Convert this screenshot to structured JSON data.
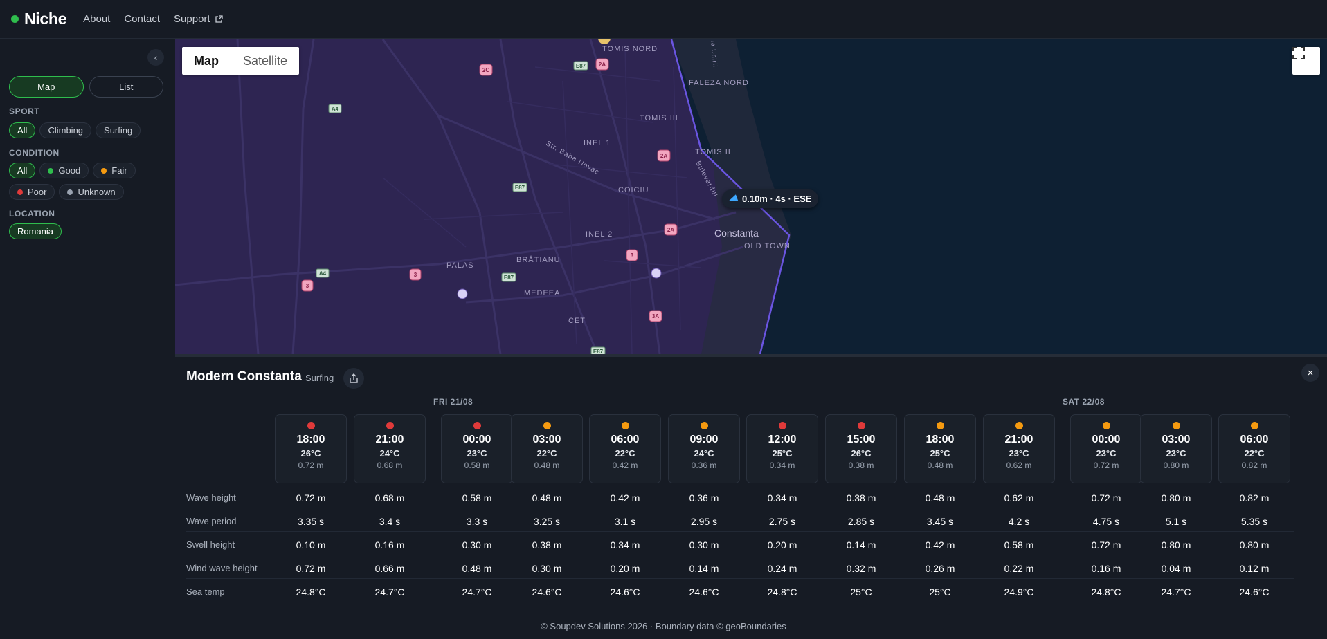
{
  "header": {
    "logo": "Niche",
    "nav": [
      "About",
      "Contact",
      "Support"
    ]
  },
  "sidebar": {
    "view_toggle": [
      "Map",
      "List"
    ],
    "sport_label": "SPORT",
    "sport": [
      "All",
      "Climbing",
      "Surfing"
    ],
    "condition_label": "CONDITION",
    "condition": [
      {
        "label": "All",
        "color": ""
      },
      {
        "label": "Good",
        "color": "#2fbd4d"
      },
      {
        "label": "Fair",
        "color": "#f59a10"
      },
      {
        "label": "Poor",
        "color": "#e03a3a"
      },
      {
        "label": "Unknown",
        "color": "#9aa3b0"
      }
    ],
    "location_label": "LOCATION",
    "location": [
      "Romania"
    ]
  },
  "map": {
    "toggle": [
      "Map",
      "Satellite"
    ],
    "wave_label": "0.10m · 4s · ESE",
    "place_labels": [
      "TOMIS NORD",
      "FALEZA NORD",
      "TOMIS III",
      "INEL 1",
      "TOMIS II",
      "Str. Baba Novac",
      "COICIU",
      "Bulevardul",
      "INEL 2",
      "Constanța",
      "OLD TOWN",
      "BRĂTIANU",
      "PALAS",
      "MEDEEA",
      "CET",
      "la Unirii"
    ],
    "road_badges": [
      "E87",
      "A4",
      "2A",
      "2C",
      "2A",
      "E87",
      "2A",
      "3",
      "3",
      "E87",
      "A4",
      "3",
      "3A",
      "E87"
    ]
  },
  "detail": {
    "title": "Modern Constanta",
    "sport": "Surfing",
    "days": [
      "FRI 21/08",
      "SAT 22/08"
    ],
    "row_labels": [
      "Wave height",
      "Wave period",
      "Swell height",
      "Wind wave height",
      "Sea temp"
    ],
    "slots": [
      {
        "time": "18:00",
        "temp": "26°C",
        "wave": "0.72 m",
        "status": "#e03a3a",
        "values": [
          "0.72 m",
          "3.35 s",
          "0.10 m",
          "0.72 m",
          "24.8°C"
        ]
      },
      {
        "time": "21:00",
        "temp": "24°C",
        "wave": "0.68 m",
        "status": "#e03a3a",
        "values": [
          "0.68 m",
          "3.4 s",
          "0.16 m",
          "0.66 m",
          "24.7°C"
        ]
      },
      {
        "time": "00:00",
        "temp": "23°C",
        "wave": "0.58 m",
        "status": "#e03a3a",
        "values": [
          "0.58 m",
          "3.3 s",
          "0.30 m",
          "0.48 m",
          "24.7°C"
        ]
      },
      {
        "time": "03:00",
        "temp": "22°C",
        "wave": "0.48 m",
        "status": "#f59a10",
        "values": [
          "0.48 m",
          "3.25 s",
          "0.38 m",
          "0.30 m",
          "24.6°C"
        ]
      },
      {
        "time": "06:00",
        "temp": "22°C",
        "wave": "0.42 m",
        "status": "#f59a10",
        "values": [
          "0.42 m",
          "3.1 s",
          "0.34 m",
          "0.20 m",
          "24.6°C"
        ]
      },
      {
        "time": "09:00",
        "temp": "24°C",
        "wave": "0.36 m",
        "status": "#f59a10",
        "values": [
          "0.36 m",
          "2.95 s",
          "0.30 m",
          "0.14 m",
          "24.6°C"
        ]
      },
      {
        "time": "12:00",
        "temp": "25°C",
        "wave": "0.34 m",
        "status": "#e03a3a",
        "values": [
          "0.34 m",
          "2.75 s",
          "0.20 m",
          "0.24 m",
          "24.8°C"
        ]
      },
      {
        "time": "15:00",
        "temp": "26°C",
        "wave": "0.38 m",
        "status": "#e03a3a",
        "values": [
          "0.38 m",
          "2.85 s",
          "0.14 m",
          "0.32 m",
          "25°C"
        ]
      },
      {
        "time": "18:00",
        "temp": "25°C",
        "wave": "0.48 m",
        "status": "#f59a10",
        "values": [
          "0.48 m",
          "3.45 s",
          "0.42 m",
          "0.26 m",
          "25°C"
        ]
      },
      {
        "time": "21:00",
        "temp": "23°C",
        "wave": "0.62 m",
        "status": "#f59a10",
        "values": [
          "0.62 m",
          "4.2 s",
          "0.58 m",
          "0.22 m",
          "24.9°C"
        ]
      },
      {
        "time": "00:00",
        "temp": "23°C",
        "wave": "0.72 m",
        "status": "#f59a10",
        "values": [
          "0.72 m",
          "4.75 s",
          "0.72 m",
          "0.16 m",
          "24.8°C"
        ]
      },
      {
        "time": "03:00",
        "temp": "23°C",
        "wave": "0.80 m",
        "status": "#f59a10",
        "values": [
          "0.80 m",
          "5.1 s",
          "0.80 m",
          "0.04 m",
          "24.7°C"
        ]
      },
      {
        "time": "06:00",
        "temp": "22°C",
        "wave": "0.82 m",
        "status": "#f59a10",
        "values": [
          "0.82 m",
          "5.35 s",
          "0.80 m",
          "0.12 m",
          "24.6°C"
        ]
      }
    ]
  },
  "footer": {
    "text": "© Soupdev Solutions 2026  ·  Boundary data © geoBoundaries"
  }
}
